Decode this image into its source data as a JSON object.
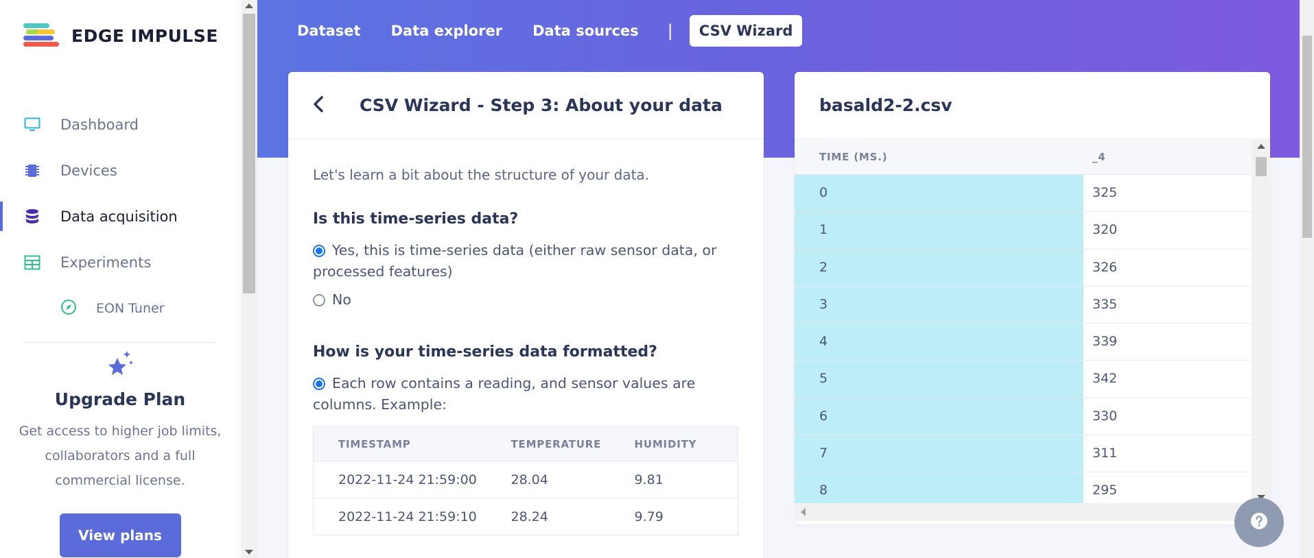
{
  "brand": {
    "name": "EDGE IMPULSE",
    "logo_colors": [
      "#4ec8c0",
      "#a6d84a",
      "#f7c531",
      "#ef5a4a",
      "#5b6bd9"
    ]
  },
  "sidebar": {
    "items": [
      {
        "label": "Dashboard",
        "icon": "monitor-icon",
        "active": false
      },
      {
        "label": "Devices",
        "icon": "chip-icon",
        "active": false
      },
      {
        "label": "Data acquisition",
        "icon": "database-icon",
        "active": true
      },
      {
        "label": "Experiments",
        "icon": "grid-icon",
        "active": false
      }
    ],
    "sub_items": [
      {
        "label": "EON Tuner",
        "icon": "compass-icon"
      }
    ],
    "upgrade": {
      "title": "Upgrade Plan",
      "text": "Get access to higher job limits, collaborators and a full commercial license.",
      "button": "View plans"
    }
  },
  "tabs": [
    {
      "label": "Dataset"
    },
    {
      "label": "Data explorer"
    },
    {
      "label": "Data sources"
    },
    {
      "label": "CSV Wizard",
      "active": true
    }
  ],
  "tab_separator": "|",
  "wizard": {
    "title": "CSV Wizard - Step 3: About your data",
    "intro": "Let's learn a bit about the structure of your data.",
    "q1": "Is this time-series data?",
    "q1_options": [
      {
        "label": "Yes, this is time-series data (either raw sensor data, or processed features)",
        "selected": true
      },
      {
        "label": "No",
        "selected": false
      }
    ],
    "q2": "How is your time-series data formatted?",
    "q2_option": {
      "label": "Each row contains a reading, and sensor values are columns. Example:",
      "selected": true
    },
    "example": {
      "headers": [
        "TIMESTAMP",
        "TEMPERATURE",
        "HUMIDITY"
      ],
      "rows": [
        [
          "2022-11-24 21:59:00",
          "28.04",
          "9.81"
        ],
        [
          "2022-11-24 21:59:10",
          "28.24",
          "9.79"
        ]
      ]
    }
  },
  "preview": {
    "filename": "basald2-2.csv",
    "headers": [
      "TIME (MS.)",
      "_4"
    ],
    "rows": [
      [
        "0",
        "325"
      ],
      [
        "1",
        "320"
      ],
      [
        "2",
        "326"
      ],
      [
        "3",
        "335"
      ],
      [
        "4",
        "339"
      ],
      [
        "5",
        "342"
      ],
      [
        "6",
        "330"
      ],
      [
        "7",
        "311"
      ],
      [
        "8",
        "295"
      ]
    ]
  },
  "help_icon": "question-icon",
  "colors": {
    "accent": "#5b6bd9",
    "highlight_column": "#bdeef8",
    "radio_selected": "#1a73e8"
  }
}
